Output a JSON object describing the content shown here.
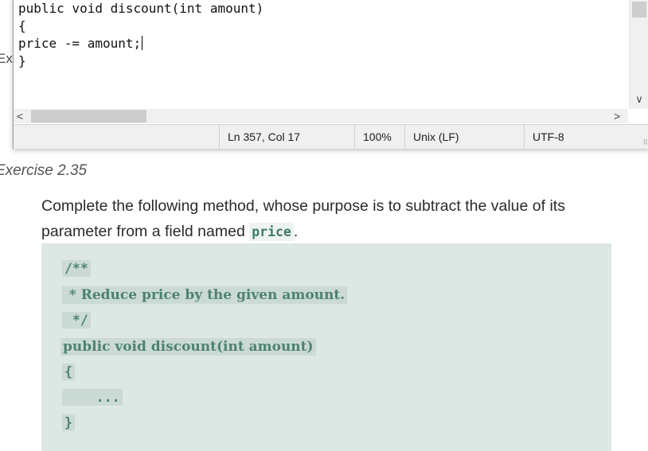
{
  "editor": {
    "lines": [
      "public void discount(int amount)",
      "{",
      "price -= amount;",
      "}"
    ],
    "status": {
      "position": "Ln 357, Col 17",
      "zoom": "100%",
      "line_ending": "Unix (LF)",
      "encoding": "UTF-8"
    },
    "scroll": {
      "left_arrow": "<",
      "right_arrow": ">",
      "down_arrow": "∨"
    }
  },
  "page": {
    "behind_label": "Exe",
    "exercise_heading": "Exercise 2.35",
    "exercise_text_before": "Complete the following method, whose purpose is to subtract the value of its parameter from a field named ",
    "exercise_code_word": "price",
    "exercise_text_after": ".",
    "code_block": {
      "lines": [
        "/**",
        " * Reduce price by the given amount.",
        " */",
        "public void discount(int amount)",
        "{",
        "    ...",
        "}"
      ]
    }
  }
}
